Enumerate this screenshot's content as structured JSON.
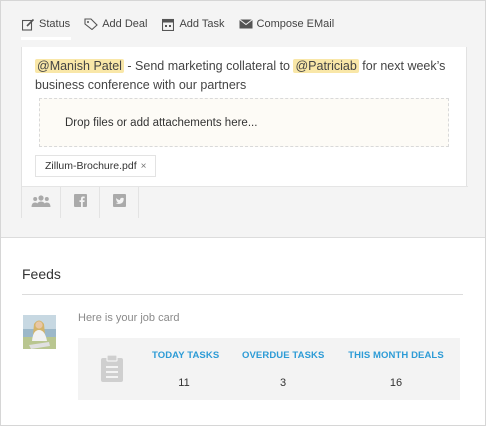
{
  "tabs": [
    {
      "label": "Status",
      "icon": "edit-icon"
    },
    {
      "label": "Add Deal",
      "icon": "tag-icon"
    },
    {
      "label": "Add Task",
      "icon": "calendar-icon"
    },
    {
      "label": "Compose EMail",
      "icon": "envelope-icon"
    }
  ],
  "composer": {
    "mention_1": "@Manish Patel",
    "text_1": " - Send marketing collateral to ",
    "mention_2": "@Patriciab",
    "text_2": " for next week’s business conference with our partners",
    "dropzone_text": "Drop files or add attachements here...",
    "attachment_name": "Zillum-Brochure.pdf",
    "attachment_remove": "×"
  },
  "share_buttons": [
    "people-icon",
    "facebook-icon",
    "twitter-icon"
  ],
  "feeds": {
    "title": "Feeds",
    "job_label": "Here is your job card",
    "stats": [
      {
        "label": "TODAY TASKS",
        "value": "11"
      },
      {
        "label": "OVERDUE TASKS",
        "value": "3"
      },
      {
        "label": "THIS MONTH DEALS",
        "value": "16"
      }
    ]
  },
  "colors": {
    "accent": "#2c9bd6",
    "mention_bg": "#f9e7a8",
    "panel_bg": "#f4f4f4"
  }
}
